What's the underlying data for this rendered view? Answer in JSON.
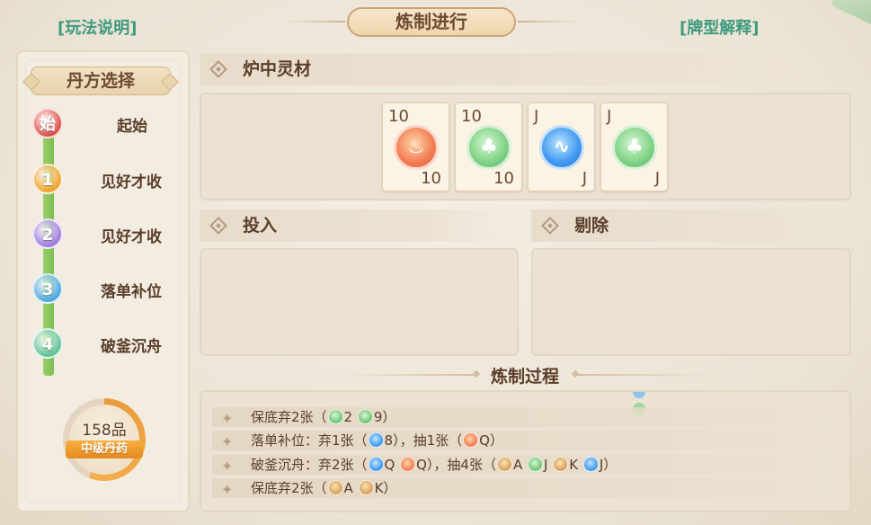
{
  "header": {
    "rules_link": "[玩法说明]",
    "title": "炼制进行",
    "card_types_link": "[牌型解释]"
  },
  "recipe_panel": {
    "title": "丹方选择",
    "steps": [
      {
        "badge": "始",
        "label": "起始",
        "color": "#e0504b"
      },
      {
        "badge": "1",
        "label": "见好才收",
        "color": "#f0a22c"
      },
      {
        "badge": "2",
        "label": "见好才收",
        "color": "#a07be0"
      },
      {
        "badge": "3",
        "label": "落单补位",
        "color": "#4aa7e0"
      },
      {
        "badge": "4",
        "label": "破釜沉舟",
        "color": "#5fc39a"
      }
    ],
    "grade": {
      "value": "158品",
      "label": "中级丹药",
      "progress": 0.56
    }
  },
  "furnace": {
    "title": "炉中灵材",
    "cards": [
      {
        "rank": "10",
        "element": "fire",
        "icon": "fire-icon"
      },
      {
        "rank": "10",
        "element": "wood",
        "icon": "wood-icon"
      },
      {
        "rank": "J",
        "element": "water",
        "icon": "water-icon"
      },
      {
        "rank": "J",
        "element": "wood",
        "icon": "wood-icon"
      }
    ]
  },
  "input_section": {
    "title": "投入"
  },
  "remove_section": {
    "title": "剔除"
  },
  "process": {
    "title": "炼制过程",
    "rows": [
      {
        "parts": [
          "保底弃2张（",
          {
            "icon": "wood"
          },
          "2 ",
          {
            "icon": "wood"
          },
          "9）"
        ]
      },
      {
        "parts": [
          "落单补位：弃1张（",
          {
            "icon": "water"
          },
          "8），抽1张（",
          {
            "icon": "fire"
          },
          "Q）"
        ]
      },
      {
        "parts": [
          "破釜沉舟：弃2张（",
          {
            "icon": "water"
          },
          "Q ",
          {
            "icon": "fire"
          },
          "Q），抽4张（",
          {
            "icon": "earth"
          },
          "A ",
          {
            "icon": "wood"
          },
          "J ",
          {
            "icon": "earth"
          },
          "K ",
          {
            "icon": "water"
          },
          "J）"
        ]
      },
      {
        "parts": [
          "保底弃2张（",
          {
            "icon": "earth"
          },
          "A ",
          {
            "icon": "earth"
          },
          "K）"
        ]
      }
    ]
  }
}
